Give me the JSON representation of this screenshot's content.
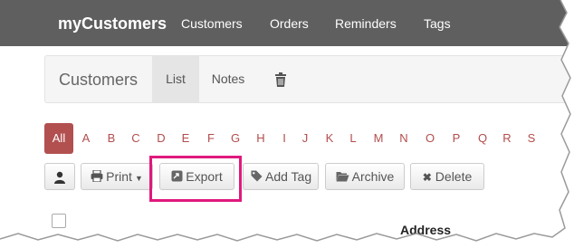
{
  "navbar": {
    "brand": "myCustomers",
    "items": [
      "Customers",
      "Orders",
      "Reminders",
      "Tags"
    ]
  },
  "subnav": {
    "title": "Customers",
    "tabs": [
      "List",
      "Notes"
    ],
    "active_tab": "List",
    "trash_icon": "trash-icon"
  },
  "alphabet": {
    "all_label": "All",
    "letters": [
      "A",
      "B",
      "C",
      "D",
      "E",
      "F",
      "G",
      "H",
      "I",
      "J",
      "K",
      "L",
      "M",
      "N",
      "O",
      "P",
      "Q",
      "R",
      "S"
    ]
  },
  "toolbar": {
    "person_icon": "user-icon",
    "print_label": "Print",
    "export_label": "Export",
    "add_tag_label": "Add Tag",
    "archive_label": "Archive",
    "delete_label": "Delete"
  },
  "table": {
    "address_header": "Address"
  },
  "colors": {
    "navbar": "#5f5f5f",
    "alpha_active": "#b25050",
    "alpha_text": "#b34d4d",
    "highlight": "#e0197d"
  }
}
